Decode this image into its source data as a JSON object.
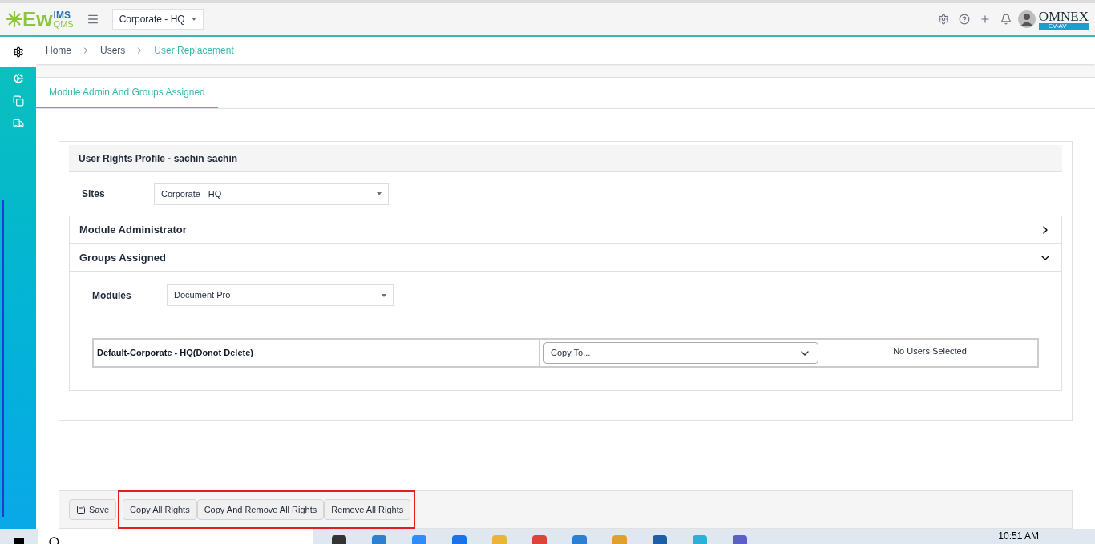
{
  "header": {
    "logo": {
      "main": "Ew",
      "sup": "IMS",
      "sub": "QMS"
    },
    "site_selector": "Corporate - HQ",
    "brand": {
      "name": "OMNEX",
      "tag": "EV-AV"
    }
  },
  "sidebar": {
    "items": [
      {
        "kind": "gear",
        "selected": true
      },
      {
        "kind": "gears",
        "selected": false
      },
      {
        "kind": "copy",
        "selected": false
      },
      {
        "kind": "truck",
        "selected": false
      }
    ]
  },
  "breadcrumb": [
    {
      "label": "Home",
      "current": false
    },
    {
      "label": "Users",
      "current": false
    },
    {
      "label": "User Replacement",
      "current": true
    }
  ],
  "tabs": [
    {
      "label": "Module Admin And Groups Assigned",
      "selected": true
    }
  ],
  "profile": {
    "title": "User Rights Profile - sachin sachin",
    "sites": {
      "label": "Sites",
      "value": "Corporate - HQ"
    },
    "sections": [
      {
        "title": "Module Administrator",
        "expanded": false
      },
      {
        "title": "Groups Assigned",
        "expanded": true
      }
    ],
    "modules": {
      "label": "Modules",
      "value": "Document Pro"
    },
    "group_row": {
      "name": "Default-Corporate - HQ(Donot Delete)",
      "copy_to": "Copy To...",
      "users": "No Users Selected"
    }
  },
  "actions": [
    {
      "label": "Save",
      "kind": "save",
      "highlighted": false
    },
    {
      "label": "Copy All Rights",
      "kind": "plain",
      "highlighted": true
    },
    {
      "label": "Copy And Remove All Rights",
      "kind": "plain",
      "highlighted": true
    },
    {
      "label": "Remove All Rights",
      "kind": "plain",
      "highlighted": true
    }
  ],
  "taskbar": {
    "clock": "10:51 AM"
  }
}
